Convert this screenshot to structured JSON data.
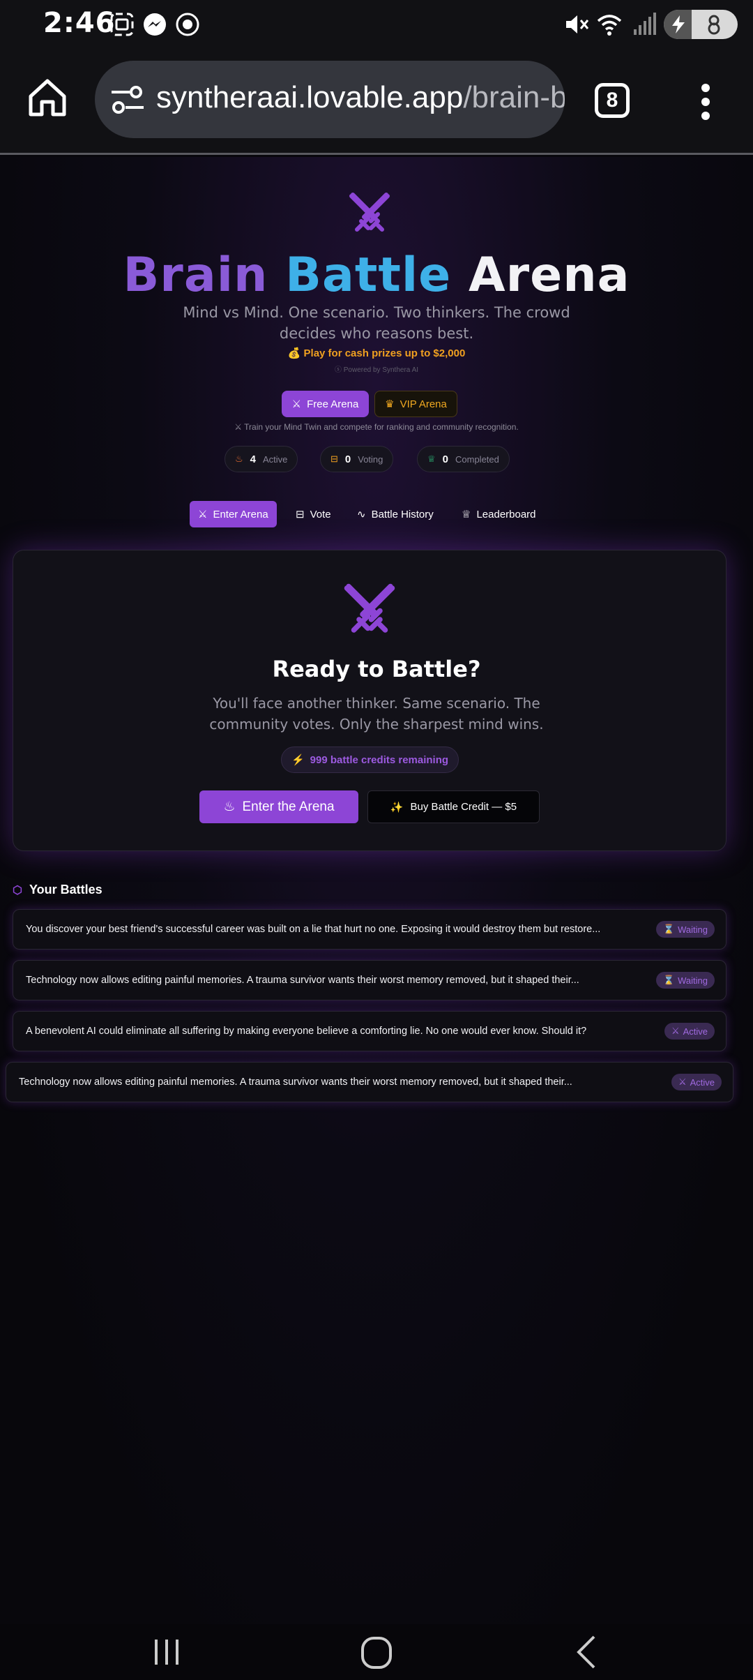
{
  "status": {
    "time": "2:46"
  },
  "browser": {
    "url_domain": "syntheraai.lovable.app",
    "url_path": "/brain-b",
    "tab_count": "8"
  },
  "hero": {
    "title_part1": "Brain",
    "title_part2": "Battle",
    "title_part3": "Arena",
    "subtitle_line1": "Mind vs Mind. One scenario. Two thinkers. The crowd",
    "subtitle_line2": "decides who reasons best.",
    "prize": "💰 Play for cash prizes up to $2,000",
    "powered": "Powered by Synthera AI"
  },
  "modes": {
    "free": "Free Arena",
    "vip": "VIP Arena"
  },
  "train_text": "Train your Mind Twin and compete for ranking and community recognition.",
  "stats": [
    {
      "value": "4",
      "label": "Active"
    },
    {
      "value": "0",
      "label": "Voting"
    },
    {
      "value": "0",
      "label": "Completed"
    }
  ],
  "tabs": [
    "Enter Arena",
    "Vote",
    "Battle History",
    "Leaderboard"
  ],
  "card": {
    "heading": "Ready to Battle?",
    "desc_line1": "You'll face another thinker. Same scenario. The",
    "desc_line2": "community votes. Only the sharpest mind wins.",
    "credits": "999 battle credits remaining",
    "enter_label": "Enter the Arena",
    "buy_label": "Buy Battle Credit — $5"
  },
  "your_battles": {
    "title": "Your Battles",
    "items": [
      {
        "text": "You discover your best friend's successful career was built on a lie that hurt no one. Exposing it would destroy them but restore...",
        "status": "Waiting"
      },
      {
        "text": "Technology now allows editing painful memories. A trauma survivor wants their worst memory removed, but it shaped their...",
        "status": "Waiting"
      },
      {
        "text": "A benevolent AI could eliminate all suffering by making everyone believe a comforting lie. No one would ever know. Should it?",
        "status": "Active"
      },
      {
        "text": "Technology now allows editing painful memories. A trauma survivor wants their worst memory removed, but it shaped their...",
        "status": "Active"
      }
    ]
  },
  "colors": {
    "accent": "#8d45d6",
    "cyan": "#3eb0e8",
    "gold": "#f0a020"
  }
}
